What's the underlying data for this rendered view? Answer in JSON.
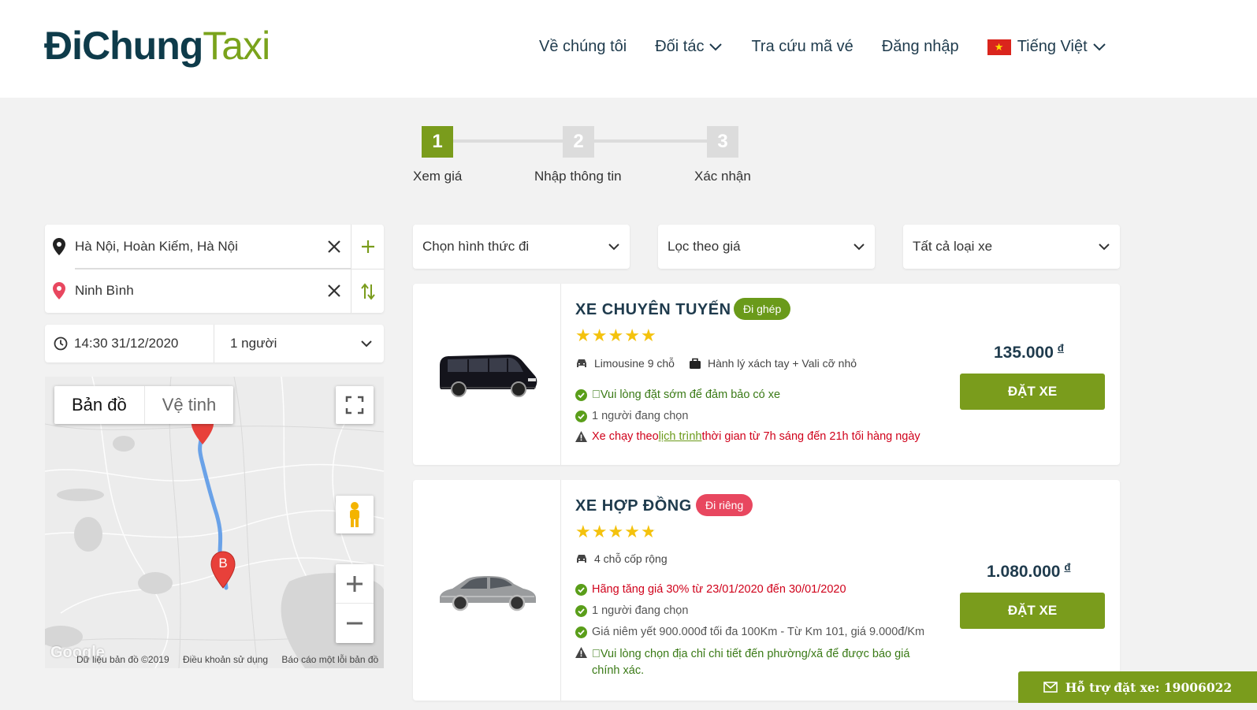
{
  "header": {
    "logo_part1": "ĐiChung",
    "logo_part2": "Taxi",
    "nav": {
      "about": "Về chúng tôi",
      "partners": "Đối tác",
      "ticket_lookup": "Tra cứu mã vé",
      "login": "Đăng nhập",
      "language": "Tiếng Việt"
    }
  },
  "stepper": {
    "steps": [
      {
        "number": "1",
        "label": "Xem giá",
        "active": true
      },
      {
        "number": "2",
        "label": "Nhập thông tin",
        "active": false
      },
      {
        "number": "3",
        "label": "Xác nhận",
        "active": false
      }
    ]
  },
  "search": {
    "origin": "Hà Nội, Hoàn Kiếm, Hà Nội",
    "destination": "Ninh Bình",
    "datetime": "14:30 31/12/2020",
    "passengers": "1 người"
  },
  "map": {
    "tab_map": "Bản đồ",
    "tab_satellite": "Vệ tinh",
    "marker_b": "B",
    "google_watermark": "Google",
    "footer": {
      "data": "Dữ liệu bản đồ ©2019",
      "terms": "Điều khoản sử dụng",
      "report": "Báo cáo một lỗi bản đồ"
    }
  },
  "filters": {
    "travel_mode": "Chọn hình thức đi",
    "price": "Lọc theo giá",
    "car_type": "Tất cả loại xe"
  },
  "cars": [
    {
      "title": "XE CHUYÊN TUYẾN",
      "badge": "Đi ghép",
      "rating": 5,
      "features": {
        "vehicle": "Limousine 9 chỗ",
        "luggage": "Hành lý xách tay + Vali cỡ nhỏ"
      },
      "notes": {
        "n1": "Vui lòng đặt sớm để đảm bảo có xe",
        "n2": "1 người đang chọn",
        "warn_pre": "Xe chạy theo ",
        "warn_link": "lịch trình",
        "warn_post": " thời gian từ 7h sáng đến 21h tối hàng ngày"
      },
      "price": "135.000",
      "currency": "đ",
      "button": "ĐẶT XE"
    },
    {
      "title": "XE HỢP ĐỒNG",
      "badge": "Đi riêng",
      "rating": 4.8,
      "features": {
        "vehicle": "4 chỗ cốp rộng"
      },
      "notes": {
        "n1": "Hãng tăng giá 30% từ 23/01/2020 đến 30/01/2020",
        "n2": "1 người đang chọn",
        "n3": "Giá niêm yết 900.000đ tối đa 100Km - Từ Km 101, giá 9.000đ/Km",
        "warn_line1": "Vui lòng chọn địa chỉ chi tiết đến phường/xã để được báo giá",
        "warn_line2": "chính xác."
      },
      "price": "1.080.000",
      "currency": "đ",
      "button": "ĐẶT XE"
    }
  ],
  "support": {
    "label": "Hỗ trợ đặt xe: 19006022"
  },
  "colors": {
    "brand_green": "#7a9c1c",
    "brand_navy": "#0e3b4a",
    "badge_share": "#6a9a1a",
    "badge_private": "#e8475f",
    "stars": "#f4c20d"
  }
}
